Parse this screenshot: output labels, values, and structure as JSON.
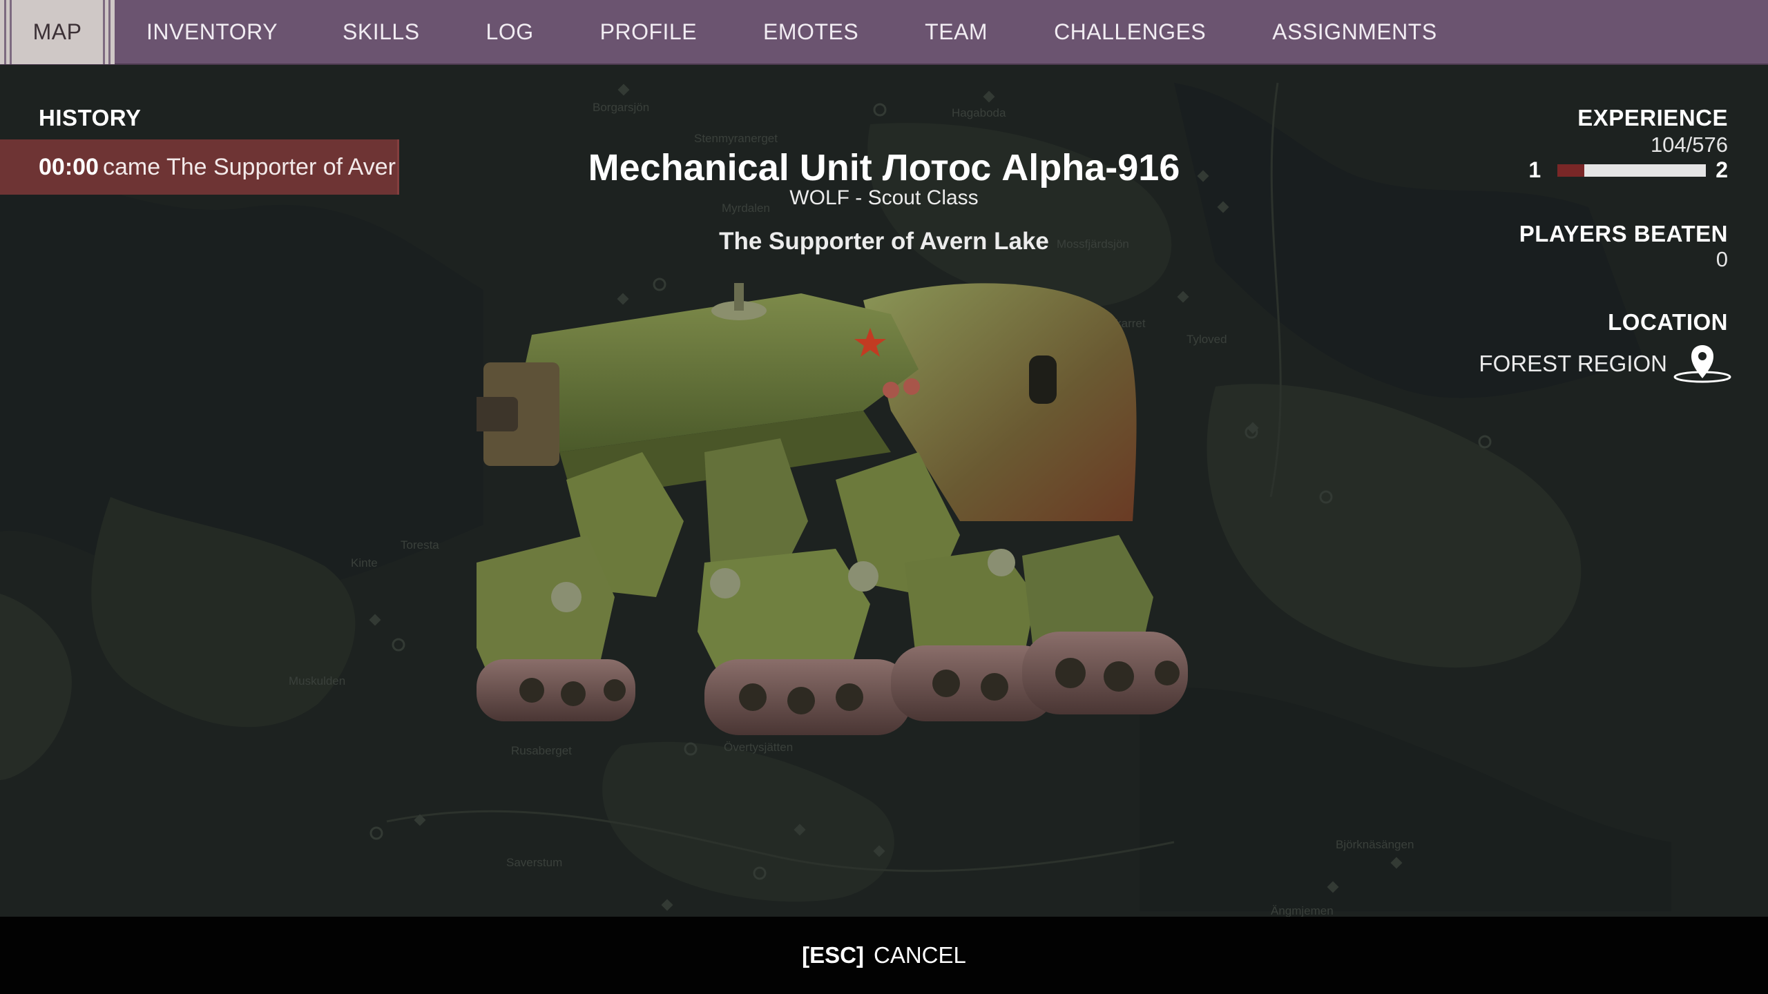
{
  "nav": {
    "tabs": [
      {
        "label": "MAP",
        "active": true
      },
      {
        "label": "INVENTORY"
      },
      {
        "label": "SKILLS"
      },
      {
        "label": "LOG"
      },
      {
        "label": "PROFILE"
      },
      {
        "label": "EMOTES"
      },
      {
        "label": "TEAM"
      },
      {
        "label": "CHALLENGES"
      },
      {
        "label": "ASSIGNMENTS"
      }
    ]
  },
  "history": {
    "title": "HISTORY",
    "entries": [
      {
        "time": "00:00",
        "text": "came The Supporter of Avern Lake"
      }
    ]
  },
  "unit": {
    "name": "Mechanical Unit Лотос Alpha-916",
    "class": "WOLF - Scout Class",
    "title": "The Supporter of Avern Lake",
    "image_icon": "tank-mech-icon"
  },
  "stats": {
    "experience_label": "EXPERIENCE",
    "experience_value": "104/576",
    "experience_fraction": 0.18,
    "level_from": "1",
    "level_to": "2",
    "players_beaten_label": "PLAYERS BEATEN",
    "players_beaten_value": "0",
    "location_label": "LOCATION",
    "location_value": "FOREST REGION",
    "location_icon": "map-pin-icon"
  },
  "map_labels": [
    "Borgarsjön",
    "Hagaboda",
    "Stenmyranerget",
    "Myrdalen",
    "Mossfjärdsjön",
    "Tyloved",
    "Sikarret",
    "Toresta",
    "Kinte",
    "Muskulden",
    "Rusaberget",
    "Övertysjätten",
    "Saverstum",
    "Björknäsängen",
    "Ängmjemen"
  ],
  "bottom": {
    "key": "[ESC]",
    "action": "CANCEL"
  },
  "colors": {
    "nav_bg": "#6b5470",
    "history_bg": "#6e3434",
    "xp_fill": "#7a2727",
    "bottom_bg": "#020202"
  }
}
